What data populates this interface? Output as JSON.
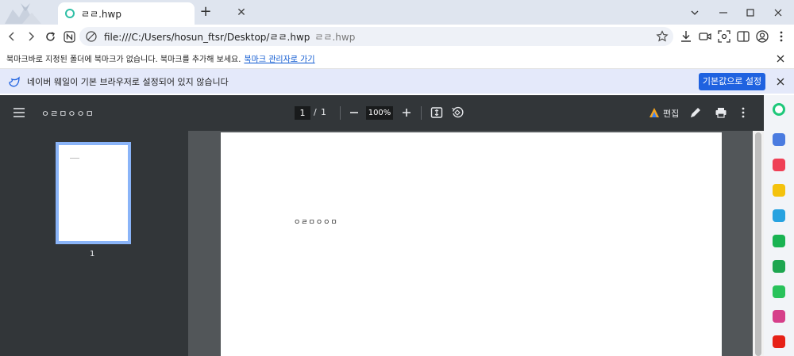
{
  "tab": {
    "title": "ㄹㄹ.hwp",
    "close": "✕",
    "new_tab": "+"
  },
  "window": {
    "minimize": "—",
    "maximize": "☐",
    "close": "✕"
  },
  "address": {
    "url": "file:///C:/Users/hosun_ftsr/Desktop/ㄹㄹ.hwp",
    "display_suffix": "ㄹㄹ.hwp"
  },
  "bookmark_bar": {
    "message": "북마크바로 지정된 폴더에 북마크가 없습니다. 북마크를 추가해 보세요.",
    "link": "북마크 관리자로 가기"
  },
  "default_bar": {
    "message": "네이버 웨일이 기본 브라우저로 설정되어 있지 않습니다",
    "button": "기본값으로 설정"
  },
  "pdf": {
    "title": "ㅇㄹㅁㅇㅇㅁ",
    "current_page": "1",
    "separator": "/",
    "total_pages": "1",
    "zoom": "100%",
    "edit_label": "편집",
    "thumb_page_number": "1",
    "page_text": "ㅇㄹㅁㅇㅇㅁ"
  },
  "colors": {
    "tab_bar": "#dfe5ef",
    "pdf_toolbar": "#323639",
    "doc_background": "#525659",
    "accent": "#1f62e0",
    "thumb_border": "#8ab4f8"
  },
  "side_panel_icons": [
    {
      "name": "green-circle-icon",
      "color": "#1ec87a"
    },
    {
      "name": "blue-app-icon",
      "color": "#4a7be0"
    },
    {
      "name": "red-pocket-icon",
      "color": "#ef4056"
    },
    {
      "name": "yellow-star-icon",
      "color": "#f4c20d"
    },
    {
      "name": "edge-icon",
      "color": "#27a2e0"
    },
    {
      "name": "green-bag-icon",
      "color": "#19b352"
    },
    {
      "name": "chart-icon",
      "color": "#1ea650"
    },
    {
      "name": "green-store-icon",
      "color": "#29c25b"
    },
    {
      "name": "instagram-icon",
      "color": "#d63f8a"
    },
    {
      "name": "youtube-icon",
      "color": "#e62117"
    }
  ]
}
